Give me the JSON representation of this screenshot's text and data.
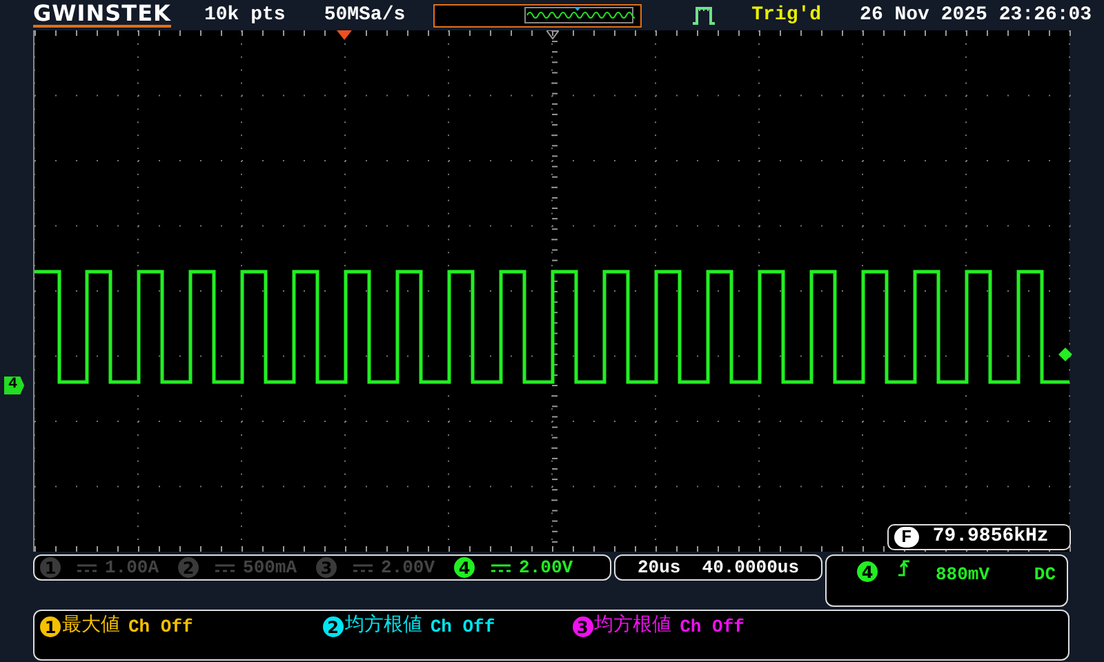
{
  "header": {
    "logo": "GWINSTEK",
    "memory": "10k pts",
    "sample_rate": "50MSa/s",
    "trigger_status": "Trig'd",
    "datetime": "26 Nov 2025 23:26:03"
  },
  "channel_marker": "4",
  "frequency": {
    "label": "F",
    "value": "79.9856kHz"
  },
  "channels": [
    {
      "number": "1",
      "scale": "1.00A",
      "on": false
    },
    {
      "number": "2",
      "scale": "500mA",
      "on": false
    },
    {
      "number": "3",
      "scale": "2.00V",
      "on": false
    },
    {
      "number": "4",
      "scale": "2.00V",
      "on": true
    }
  ],
  "timebase": {
    "scale": "20us",
    "position": "40.0000us"
  },
  "trigger": {
    "source": "4",
    "level": "880mV",
    "coupling": "DC"
  },
  "measurements": [
    {
      "number": "1",
      "name": "最大値",
      "value": "Ch Off",
      "color": "#f5c000"
    },
    {
      "number": "2",
      "name": "均方根値",
      "value": "Ch Off",
      "color": "#00e5f0"
    },
    {
      "number": "3",
      "name": "均方根値",
      "value": "Ch Off",
      "color": "#f010f0"
    }
  ]
}
